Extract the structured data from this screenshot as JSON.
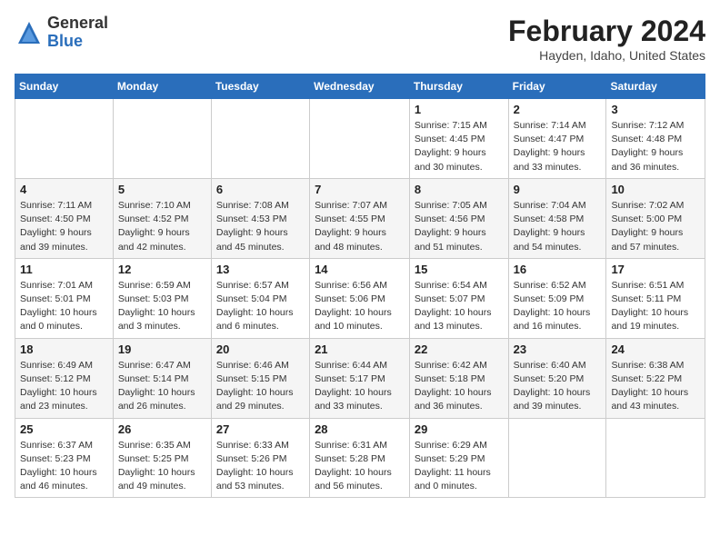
{
  "logo": {
    "general": "General",
    "blue": "Blue"
  },
  "title": "February 2024",
  "subtitle": "Hayden, Idaho, United States",
  "days_of_week": [
    "Sunday",
    "Monday",
    "Tuesday",
    "Wednesday",
    "Thursday",
    "Friday",
    "Saturday"
  ],
  "weeks": [
    [
      {
        "num": "",
        "info": ""
      },
      {
        "num": "",
        "info": ""
      },
      {
        "num": "",
        "info": ""
      },
      {
        "num": "",
        "info": ""
      },
      {
        "num": "1",
        "info": "Sunrise: 7:15 AM\nSunset: 4:45 PM\nDaylight: 9 hours\nand 30 minutes."
      },
      {
        "num": "2",
        "info": "Sunrise: 7:14 AM\nSunset: 4:47 PM\nDaylight: 9 hours\nand 33 minutes."
      },
      {
        "num": "3",
        "info": "Sunrise: 7:12 AM\nSunset: 4:48 PM\nDaylight: 9 hours\nand 36 minutes."
      }
    ],
    [
      {
        "num": "4",
        "info": "Sunrise: 7:11 AM\nSunset: 4:50 PM\nDaylight: 9 hours\nand 39 minutes."
      },
      {
        "num": "5",
        "info": "Sunrise: 7:10 AM\nSunset: 4:52 PM\nDaylight: 9 hours\nand 42 minutes."
      },
      {
        "num": "6",
        "info": "Sunrise: 7:08 AM\nSunset: 4:53 PM\nDaylight: 9 hours\nand 45 minutes."
      },
      {
        "num": "7",
        "info": "Sunrise: 7:07 AM\nSunset: 4:55 PM\nDaylight: 9 hours\nand 48 minutes."
      },
      {
        "num": "8",
        "info": "Sunrise: 7:05 AM\nSunset: 4:56 PM\nDaylight: 9 hours\nand 51 minutes."
      },
      {
        "num": "9",
        "info": "Sunrise: 7:04 AM\nSunset: 4:58 PM\nDaylight: 9 hours\nand 54 minutes."
      },
      {
        "num": "10",
        "info": "Sunrise: 7:02 AM\nSunset: 5:00 PM\nDaylight: 9 hours\nand 57 minutes."
      }
    ],
    [
      {
        "num": "11",
        "info": "Sunrise: 7:01 AM\nSunset: 5:01 PM\nDaylight: 10 hours\nand 0 minutes."
      },
      {
        "num": "12",
        "info": "Sunrise: 6:59 AM\nSunset: 5:03 PM\nDaylight: 10 hours\nand 3 minutes."
      },
      {
        "num": "13",
        "info": "Sunrise: 6:57 AM\nSunset: 5:04 PM\nDaylight: 10 hours\nand 6 minutes."
      },
      {
        "num": "14",
        "info": "Sunrise: 6:56 AM\nSunset: 5:06 PM\nDaylight: 10 hours\nand 10 minutes."
      },
      {
        "num": "15",
        "info": "Sunrise: 6:54 AM\nSunset: 5:07 PM\nDaylight: 10 hours\nand 13 minutes."
      },
      {
        "num": "16",
        "info": "Sunrise: 6:52 AM\nSunset: 5:09 PM\nDaylight: 10 hours\nand 16 minutes."
      },
      {
        "num": "17",
        "info": "Sunrise: 6:51 AM\nSunset: 5:11 PM\nDaylight: 10 hours\nand 19 minutes."
      }
    ],
    [
      {
        "num": "18",
        "info": "Sunrise: 6:49 AM\nSunset: 5:12 PM\nDaylight: 10 hours\nand 23 minutes."
      },
      {
        "num": "19",
        "info": "Sunrise: 6:47 AM\nSunset: 5:14 PM\nDaylight: 10 hours\nand 26 minutes."
      },
      {
        "num": "20",
        "info": "Sunrise: 6:46 AM\nSunset: 5:15 PM\nDaylight: 10 hours\nand 29 minutes."
      },
      {
        "num": "21",
        "info": "Sunrise: 6:44 AM\nSunset: 5:17 PM\nDaylight: 10 hours\nand 33 minutes."
      },
      {
        "num": "22",
        "info": "Sunrise: 6:42 AM\nSunset: 5:18 PM\nDaylight: 10 hours\nand 36 minutes."
      },
      {
        "num": "23",
        "info": "Sunrise: 6:40 AM\nSunset: 5:20 PM\nDaylight: 10 hours\nand 39 minutes."
      },
      {
        "num": "24",
        "info": "Sunrise: 6:38 AM\nSunset: 5:22 PM\nDaylight: 10 hours\nand 43 minutes."
      }
    ],
    [
      {
        "num": "25",
        "info": "Sunrise: 6:37 AM\nSunset: 5:23 PM\nDaylight: 10 hours\nand 46 minutes."
      },
      {
        "num": "26",
        "info": "Sunrise: 6:35 AM\nSunset: 5:25 PM\nDaylight: 10 hours\nand 49 minutes."
      },
      {
        "num": "27",
        "info": "Sunrise: 6:33 AM\nSunset: 5:26 PM\nDaylight: 10 hours\nand 53 minutes."
      },
      {
        "num": "28",
        "info": "Sunrise: 6:31 AM\nSunset: 5:28 PM\nDaylight: 10 hours\nand 56 minutes."
      },
      {
        "num": "29",
        "info": "Sunrise: 6:29 AM\nSunset: 5:29 PM\nDaylight: 11 hours\nand 0 minutes."
      },
      {
        "num": "",
        "info": ""
      },
      {
        "num": "",
        "info": ""
      }
    ]
  ]
}
